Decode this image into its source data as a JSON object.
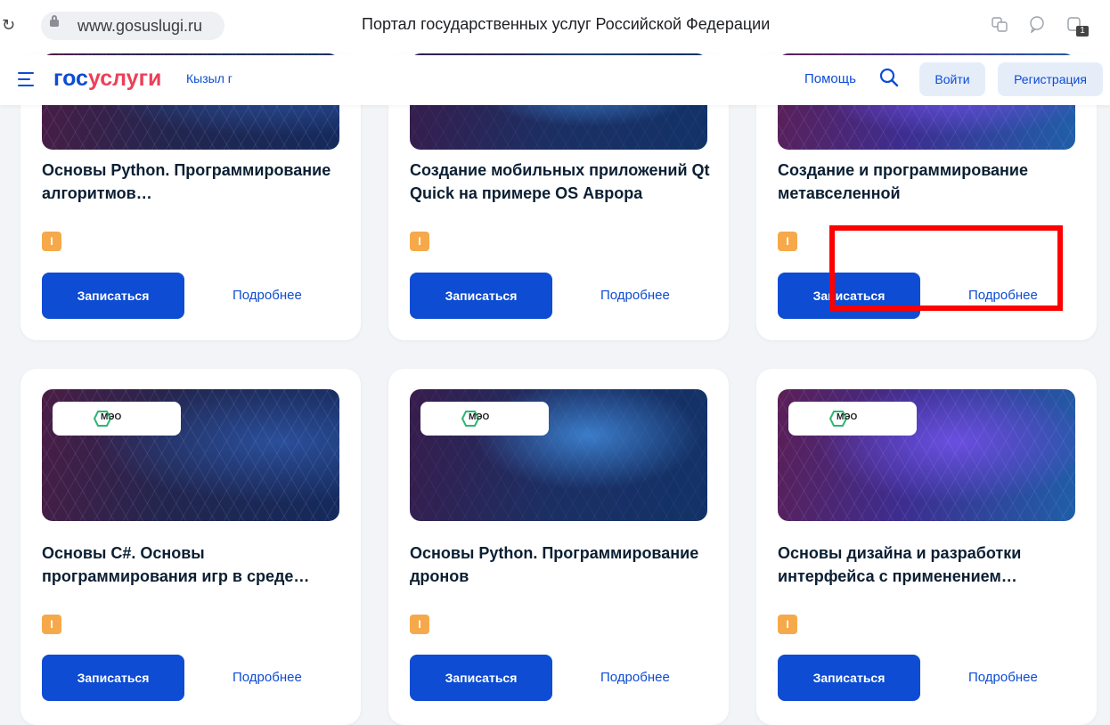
{
  "browser": {
    "url": "www.gosuslugi.ru",
    "page_title": "Портал государственных услуг Российской Федерации",
    "tab_count": "1"
  },
  "header": {
    "logo_part1": "гос",
    "logo_part2": "услуги",
    "location": "Кызыл г",
    "help": "Помощь",
    "login": "Войти",
    "register": "Регистрация",
    "brand_color": "#0d4cd3",
    "accent_color": "#ee3f58"
  },
  "cards_top": [
    {
      "title": "Основы Python. Программирование алгоритмов…",
      "level": "I",
      "enroll": "Записаться",
      "more": "Подробнее"
    },
    {
      "title": "Создание мобильных приложений Qt Quick на примере OS Аврора",
      "level": "I",
      "enroll": "Записаться",
      "more": "Подробнее"
    },
    {
      "title": "Создание и программирование метавселенной",
      "level": "I",
      "enroll": "Записаться",
      "more": "Подробнее"
    }
  ],
  "cards_bottom": [
    {
      "title": "Основы C#. Основы программирования игр в среде…",
      "level": "I",
      "enroll": "Записаться",
      "more": "Подробнее",
      "logo": "МЭО"
    },
    {
      "title": "Основы Python. Программирование дронов",
      "level": "I",
      "enroll": "Записаться",
      "more": "Подробнее",
      "logo": "МЭО"
    },
    {
      "title": "Основы дизайна и разработки интерфейса с применением…",
      "level": "I",
      "enroll": "Записаться",
      "more": "Подробнее",
      "logo": "МЭО"
    }
  ],
  "annotation_color": "#ff0000"
}
